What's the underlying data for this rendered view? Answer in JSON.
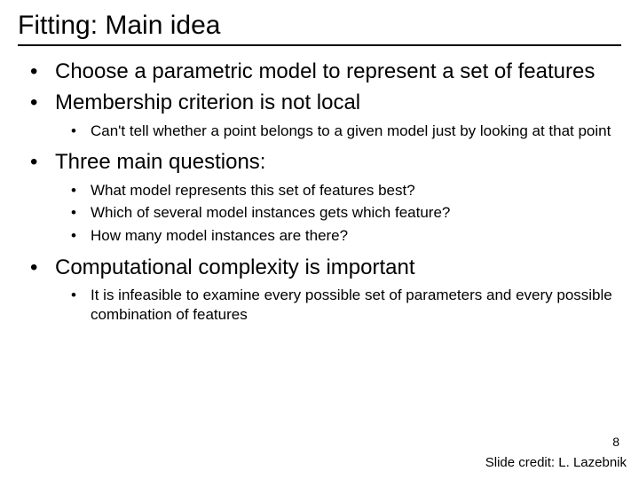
{
  "title": "Fitting: Main idea",
  "bullets": {
    "b1": "Choose a parametric model to represent a set of features",
    "b2": "Membership criterion is not local",
    "b2a": "Can't tell whether a point belongs to a given model just by looking at that point",
    "b3": "Three main questions:",
    "b3a": "What model represents this set of features best?",
    "b3b": "Which of several model instances gets which feature?",
    "b3c": "How many model instances are there?",
    "b4": "Computational complexity is important",
    "b4a": "It is infeasible to examine every possible set of parameters and every possible combination of features"
  },
  "page_number": "8",
  "credit": "Slide credit: L. Lazebnik"
}
